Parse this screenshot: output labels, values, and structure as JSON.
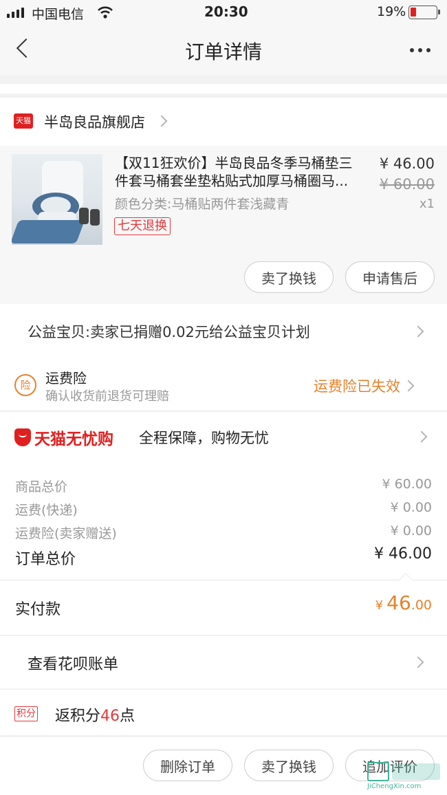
{
  "status_bar": {
    "carrier": "中国电信",
    "time": "20:30",
    "battery": "19%"
  },
  "nav": {
    "title": "订单详情"
  },
  "store": {
    "badge": "天猫",
    "name": "半岛良品旗舰店"
  },
  "product": {
    "title_line1": "【双11狂欢价】半岛良品冬季马桶垫三",
    "title_line2": "件套马桶套坐垫粘贴式加厚马桶圈马...",
    "sku": "颜色分类:马桶贴两件套浅藏青",
    "tag": "七天退换",
    "price": "¥ 46.00",
    "original_price": "¥ 60.00",
    "quantity": "x1"
  },
  "item_actions": {
    "sell_label": "卖了换钱",
    "after_sales_label": "申请售后"
  },
  "charity": {
    "text": "公益宝贝:卖家已捐赠0.02元给公益宝贝计划"
  },
  "shipping_insurance": {
    "icon_char": "险",
    "title": "运费险",
    "subtitle": "确认收货前退货可理赔",
    "status": "运费险已失效"
  },
  "tmall_guarantee": {
    "brand": "天猫无忧购",
    "text": "全程保障，购物无忧"
  },
  "price_summary": {
    "rows": [
      {
        "label": "商品总价",
        "value": "¥ 60.00"
      },
      {
        "label": "运费(快递)",
        "value": "¥ 0.00"
      },
      {
        "label": "运费险(卖家赠送)",
        "value": "¥ 0.00"
      }
    ],
    "total_label": "订单总价",
    "total_value": "¥ 46.00",
    "paid_label": "实付款",
    "paid_currency": "¥",
    "paid_int": "46",
    "paid_dec": ".00"
  },
  "huabei": {
    "text": "查看花呗账单"
  },
  "points": {
    "badge": "积分",
    "prefix": "返积分",
    "value": "46",
    "suffix": "点"
  },
  "bottom_actions": {
    "delete_label": "删除订单",
    "sell_label": "卖了换钱",
    "review_label": "追加评价"
  },
  "watermark": {
    "text": "JiChengXin.com"
  },
  "colors": {
    "accent_red": "#e4393c",
    "orange": "#e5822d",
    "tmall_red": "#e02020"
  }
}
